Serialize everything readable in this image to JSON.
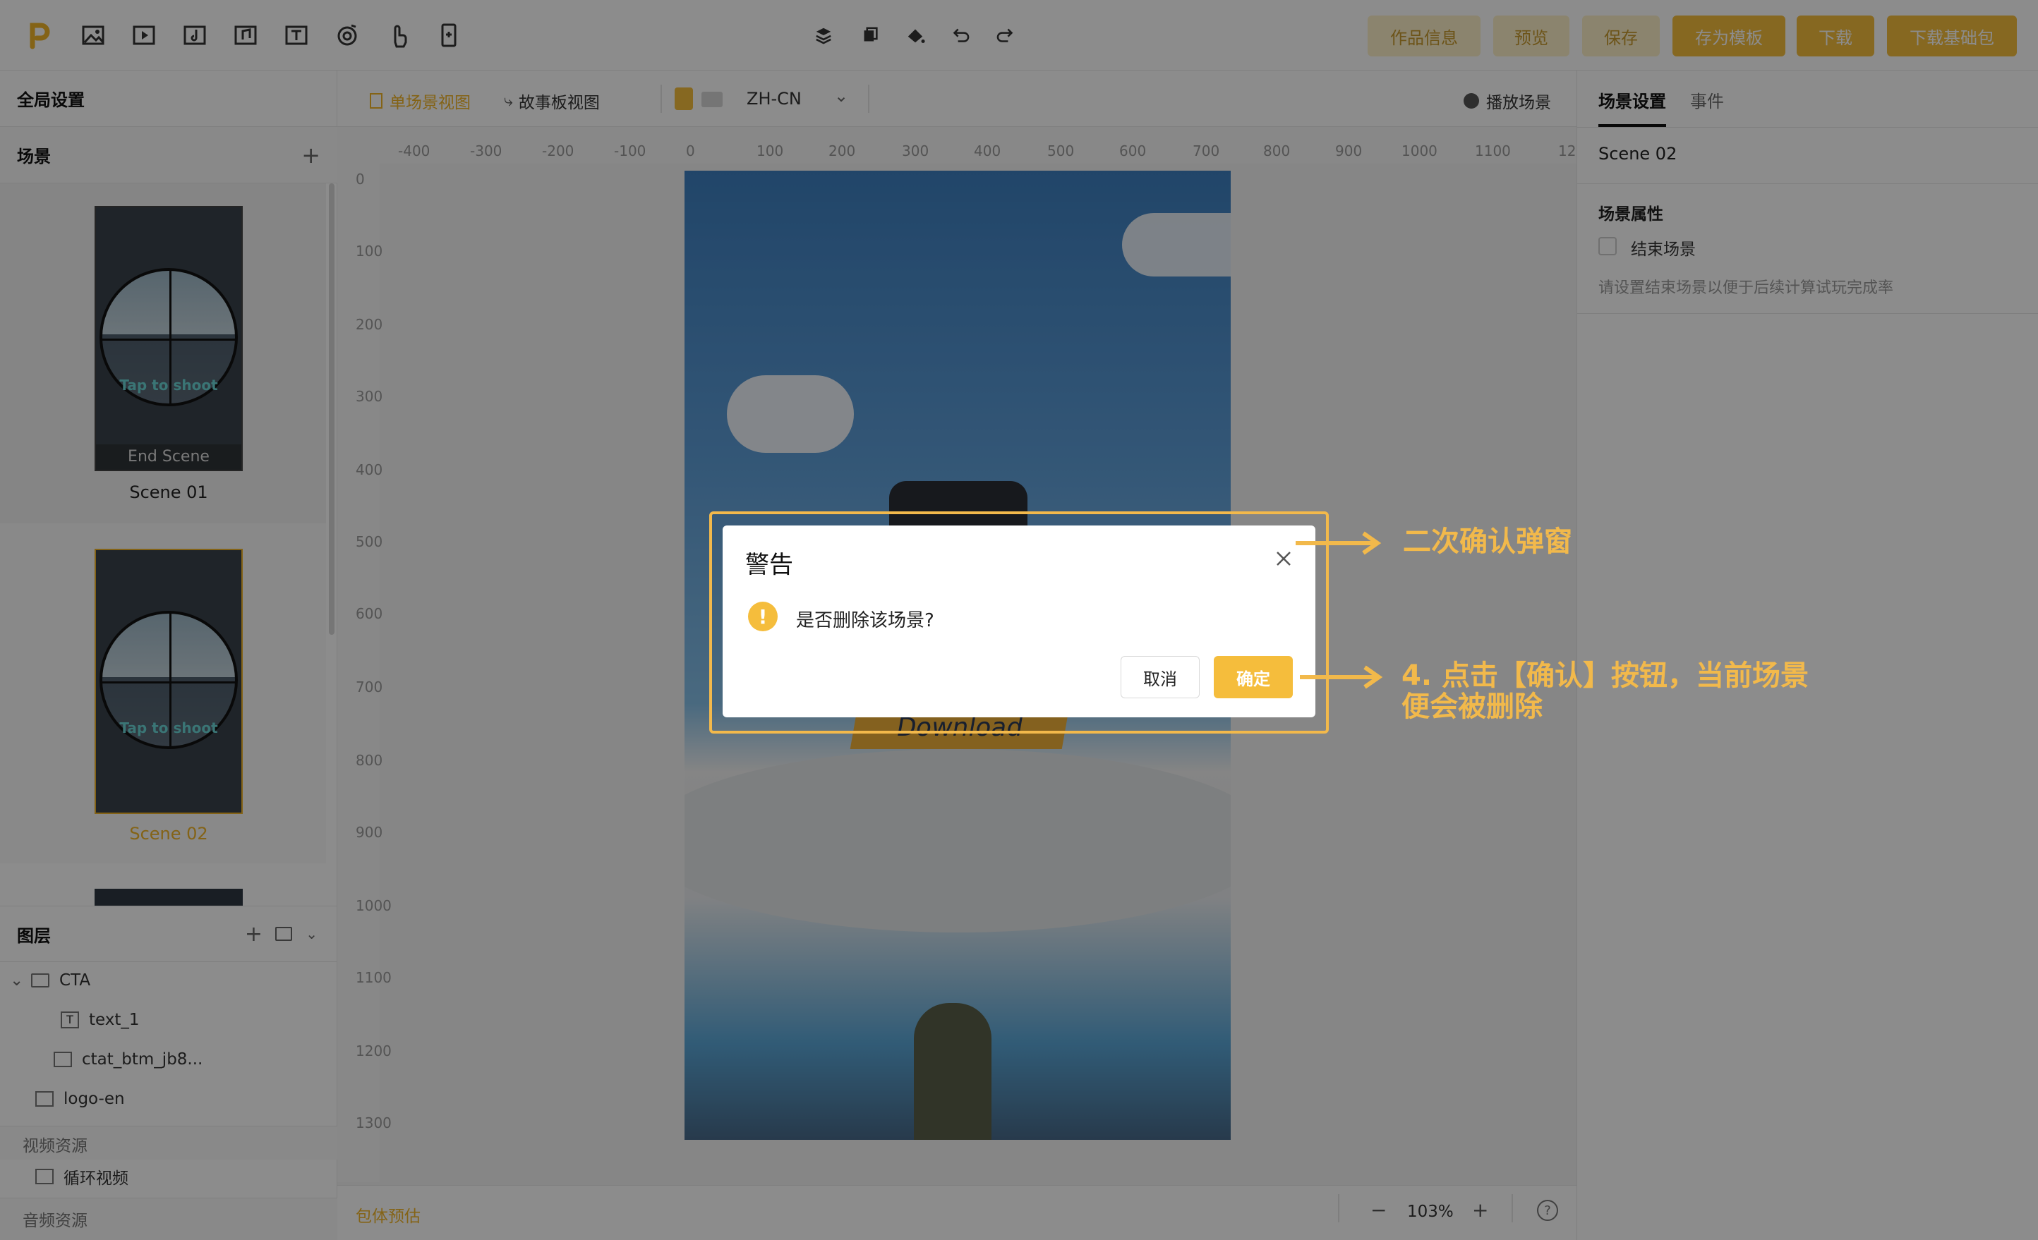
{
  "toolbar": {
    "tools": [
      "logo-icon",
      "image-icon",
      "video-icon",
      "audio-icon",
      "music-icon",
      "text-icon",
      "target-icon",
      "hand-icon",
      "device-icon"
    ],
    "center_tools": [
      "layers-icon",
      "copy-icon",
      "paint-icon",
      "undo-icon",
      "redo-icon"
    ],
    "buttons": {
      "info": "作品信息",
      "preview": "预览",
      "save": "保存",
      "save_template": "存为模板",
      "download": "下载",
      "download_base": "下载基础包"
    }
  },
  "left": {
    "global": "全局设置",
    "scenes_title": "场景",
    "scenes": [
      {
        "label": "Scene 01",
        "badge": "End Scene",
        "overlay_text": "Tap to shoot"
      },
      {
        "label": "Scene 02",
        "overlay_text": "Tap to shoot"
      }
    ],
    "layers_title": "图层",
    "layers": {
      "group": "CTA",
      "child1": "text_1",
      "child2": "ctat_btm_jb8...",
      "item": "logo-en"
    },
    "video_section": "视频资源",
    "video_item": "循环视频",
    "audio_section": "音频资源"
  },
  "canvas": {
    "view_single": "单场景视图",
    "view_story": "故事板视图",
    "language": "ZH-CN",
    "play": "播放场景",
    "ruler_h": [
      "-400",
      "-300",
      "-200",
      "-100",
      "0",
      "100",
      "200",
      "300",
      "400",
      "500",
      "600",
      "700",
      "800",
      "900",
      "1000",
      "1100",
      "12"
    ],
    "ruler_v": [
      "0",
      "100",
      "200",
      "300",
      "400",
      "500",
      "600",
      "700",
      "800",
      "900",
      "1000",
      "1100",
      "1200",
      "1300"
    ],
    "package_estimate": "包体预估",
    "zoom": "103%",
    "zoom_minus": "−",
    "zoom_plus": "+",
    "help": "?",
    "phone_text": "Download"
  },
  "right": {
    "tab_scene": "场景设置",
    "tab_event": "事件",
    "scene_name": "Scene 02",
    "props_title": "场景属性",
    "end_scene_label": "结束场景",
    "hint": "请设置结束场景以便于后续计算试玩完成率"
  },
  "dialog": {
    "title": "警告",
    "message": "是否删除该场景?",
    "cancel": "取消",
    "confirm": "确定"
  },
  "annotations": {
    "a1": "二次确认弹窗",
    "a2_line1": "4. 点击【确认】按钮，当前场景",
    "a2_line2": "便会被删除"
  },
  "colors": {
    "accent": "#f5bd3c",
    "annotation": "#f2b94b"
  }
}
